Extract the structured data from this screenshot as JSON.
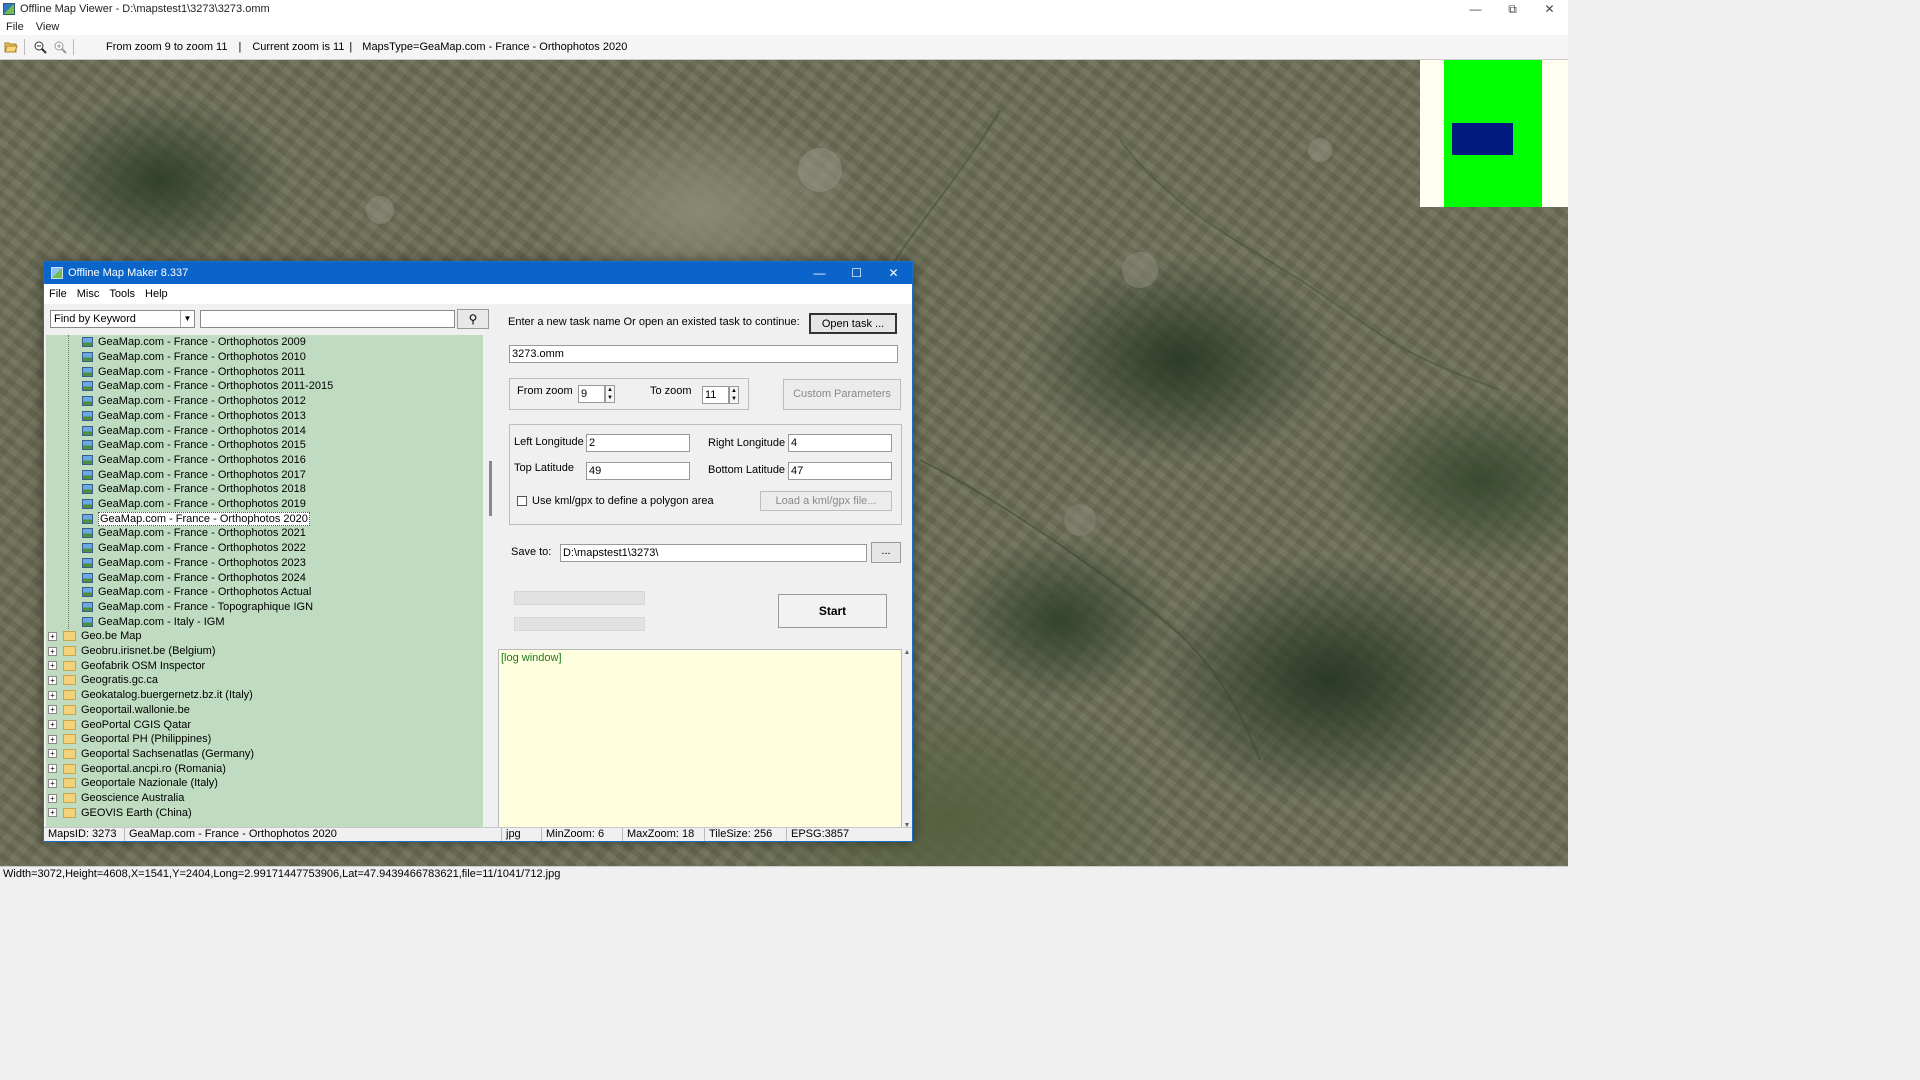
{
  "window": {
    "title": "Offline Map Viewer - D:\\mapstest1\\3273\\3273.omm",
    "controls": [
      "—",
      "⧉",
      "✕"
    ]
  },
  "menu": [
    "File",
    "View"
  ],
  "toolbar": {
    "icons": [
      "open-folder-icon",
      "zoom-out-icon",
      "zoom-in-icon"
    ],
    "zoom_range": "From zoom 9 to zoom 11",
    "sep1": "|",
    "current_zoom": "Current zoom is 11",
    "sep2": "|",
    "maps_type": "MapsType=GeaMap.com - France - Orthophotos 2020"
  },
  "statusbar": "Width=3072,Height=4608,X=1541,Y=2404,Long=2.99171447753906,Lat=47.9439466783621,file=11/1041/712.jpg",
  "minimap": {
    "frame_color": "#fffef0",
    "area_color": "#00ff00",
    "view_color": "#001a80"
  },
  "dialog": {
    "title": "Offline Map Maker 8.337",
    "controls": [
      "—",
      "☐",
      "✕"
    ],
    "menu": [
      "File",
      "Misc",
      "Tools",
      "Help"
    ],
    "find_mode": "Find by Keyword",
    "search_value": "",
    "tree": {
      "map_items": [
        "GeaMap.com - France - Orthophotos 2009",
        "GeaMap.com - France - Orthophotos 2010",
        "GeaMap.com - France - Orthophotos 2011",
        "GeaMap.com - France - Orthophotos 2011-2015",
        "GeaMap.com - France - Orthophotos 2012",
        "GeaMap.com - France - Orthophotos 2013",
        "GeaMap.com - France - Orthophotos 2014",
        "GeaMap.com - France - Orthophotos 2015",
        "GeaMap.com - France - Orthophotos 2016",
        "GeaMap.com - France - Orthophotos 2017",
        "GeaMap.com - France - Orthophotos 2018",
        "GeaMap.com - France - Orthophotos 2019",
        "GeaMap.com - France - Orthophotos 2020",
        "GeaMap.com - France - Orthophotos 2021",
        "GeaMap.com - France - Orthophotos 2022",
        "GeaMap.com - France - Orthophotos 2023",
        "GeaMap.com - France - Orthophotos 2024",
        "GeaMap.com - France - Orthophotos Actual",
        "GeaMap.com - France - Topographique IGN",
        "GeaMap.com - Italy - IGM"
      ],
      "selected_index": 12,
      "folders": [
        "Geo.be Map",
        "Geobru.irisnet.be (Belgium)",
        "Geofabrik OSM Inspector",
        "Geogratis.gc.ca",
        "Geokatalog.buergernetz.bz.it (Italy)",
        "Geoportail.wallonie.be",
        "GeoPortal CGIS Qatar",
        "Geoportal PH (Philippines)",
        "Geoportal Sachsenatlas (Germany)",
        "Geoportal.ancpi.ro (Romania)",
        "Geoportale Nazionale (Italy)",
        "Geoscience Australia",
        "GEOVIS Earth (China)"
      ]
    },
    "task": {
      "prompt": "Enter a new task name Or open an existed task to continue:",
      "open_button": "Open task ...",
      "task_name": "3273.omm"
    },
    "zoom": {
      "from_label": "From zoom",
      "from_value": "9",
      "to_label": "To zoom",
      "to_value": "11",
      "custom_button": "Custom Parameters"
    },
    "bounds": {
      "left_lon_label": "Left Longitude",
      "left_lon": "2",
      "right_lon_label": "Right Longitude",
      "right_lon": "4",
      "top_lat_label": "Top Latitude",
      "top_lat": "49",
      "bottom_lat_label": "Bottom Latitude",
      "bottom_lat": "47",
      "kml_checkbox_label": "Use kml/gpx to define a polygon area",
      "kml_checked": false,
      "kml_button": "Load a kml/gpx file..."
    },
    "save": {
      "label": "Save to:",
      "path": "D:\\mapstest1\\3273\\",
      "browse_button": "..."
    },
    "start_button": "Start",
    "log_text": "[log window]",
    "status": {
      "maps_id": "MapsID: 3273",
      "maps_name": "GeaMap.com - France - Orthophotos 2020",
      "format": "jpg",
      "min_zoom": "MinZoom: 6",
      "max_zoom": "MaxZoom: 18",
      "tile_size": "TileSize: 256",
      "epsg": "EPSG:3857"
    }
  }
}
